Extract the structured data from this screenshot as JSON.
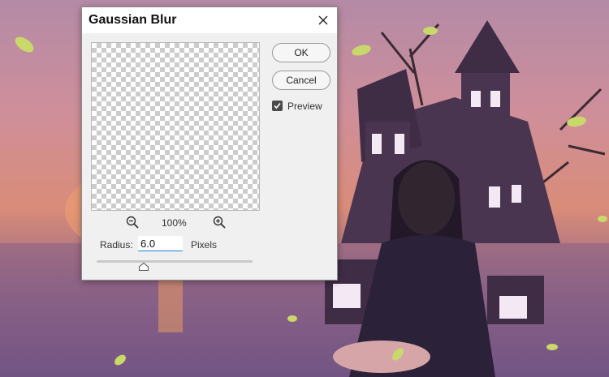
{
  "dialog": {
    "title": "Gaussian Blur",
    "close_icon": "close-icon",
    "ok_label": "OK",
    "cancel_label": "Cancel",
    "preview_label": "Preview",
    "preview_checked": true,
    "zoom_level": "100%",
    "zoom_out_icon": "zoom-out-icon",
    "zoom_in_icon": "zoom-in-icon",
    "radius_label": "Radius:",
    "radius_value": "6.0",
    "radius_unit": "Pixels",
    "slider_fraction": 0.3
  },
  "colors": {
    "accent": "#2a7bd3",
    "dialog_bg": "#f0f0f0"
  }
}
